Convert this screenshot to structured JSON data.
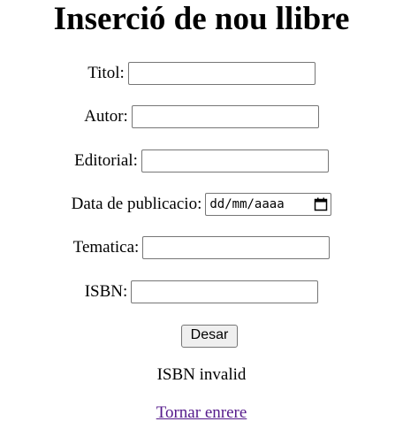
{
  "page": {
    "title": "Inserció de nou llibre"
  },
  "form": {
    "fields": [
      {
        "label": "Titol:",
        "value": ""
      },
      {
        "label": "Autor:",
        "value": ""
      },
      {
        "label": "Editorial:",
        "value": ""
      },
      {
        "label": "Data de publicacio:",
        "placeholder": "dd/mm/aaaa"
      },
      {
        "label": "Tematica:",
        "value": ""
      },
      {
        "label": "ISBN:",
        "value": ""
      }
    ],
    "submit_label": "Desar"
  },
  "message": "ISBN invalid",
  "back_link": "Tornar enrere",
  "icons": {
    "date": "calendar-icon"
  }
}
